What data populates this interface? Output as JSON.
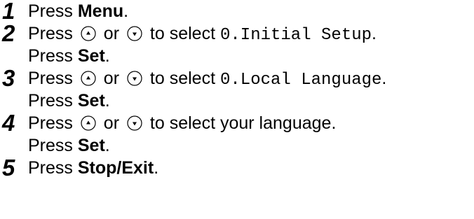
{
  "steps": [
    {
      "number": "1",
      "lines": [
        {
          "pre": "Press ",
          "bold": "Menu",
          "post": "."
        }
      ]
    },
    {
      "number": "2",
      "lines": [
        {
          "pre": "Press ",
          "or": " or ",
          "mid": " to select ",
          "mono": "0.Initial Setup",
          "post": "."
        },
        {
          "pre": "Press ",
          "bold": "Set",
          "post": "."
        }
      ]
    },
    {
      "number": "3",
      "lines": [
        {
          "pre": "Press ",
          "or": " or ",
          "mid": " to select ",
          "mono": "0.Local Language",
          "post": "."
        },
        {
          "pre": "Press ",
          "bold": "Set",
          "post": "."
        }
      ]
    },
    {
      "number": "4",
      "lines": [
        {
          "pre": "Press ",
          "or": " or ",
          "mid": " to select your language."
        },
        {
          "pre": "Press ",
          "bold": "Set",
          "post": "."
        }
      ]
    },
    {
      "number": "5",
      "lines": [
        {
          "pre": "Press ",
          "bold": "Stop/Exit",
          "post": "."
        }
      ]
    }
  ],
  "icons": {
    "up": "up-arrow-key-icon",
    "down": "down-arrow-key-icon"
  }
}
